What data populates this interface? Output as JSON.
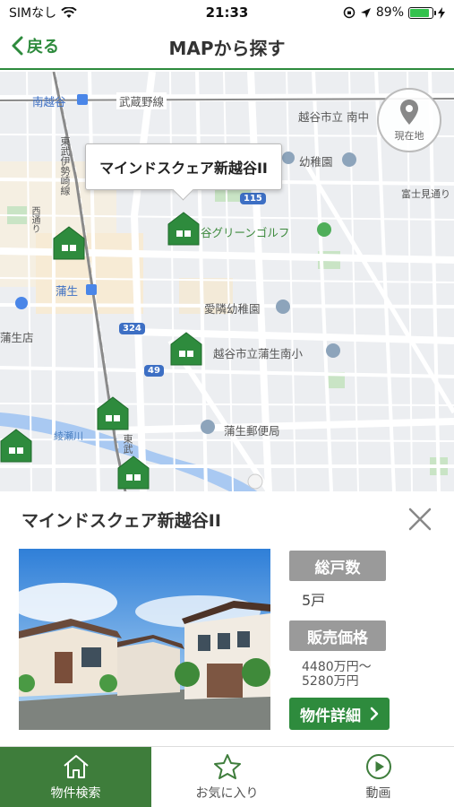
{
  "status_bar": {
    "carrier": "SIMなし",
    "time": "21:33",
    "battery": "89%",
    "battery_level": 0.89
  },
  "nav": {
    "back_label": "戻る",
    "title": "MAPから探す"
  },
  "map": {
    "labels": {
      "minamikoshigaya": "南越谷",
      "musashino_line": "武蔵野線",
      "koshigaya_school": "越谷市立 南中",
      "tobu_isesaki": "東武伊勢崎線",
      "kindergarten1": "幼稚園",
      "fujimi": "富士見通り",
      "golf": "谷グリーンゴルフ",
      "gamo": "蒲生",
      "aizen": "愛隣幼稚園",
      "gamo_store": "蒲生店",
      "gamo_minami": "越谷市立蒲生南小",
      "post_office": "蒲生郵便局",
      "ayase": "綾瀬川",
      "tobu": "東武",
      "road_left": "西通り"
    },
    "shields": [
      "115",
      "324",
      "49"
    ],
    "callout_title": "マインドスクェア新越谷II",
    "locate_label": "現在地"
  },
  "detail": {
    "title": "マインドスクェア新越谷II",
    "units_label": "総戸数",
    "units_value": "5戸",
    "price_label": "販売価格",
    "price_line1": "4480万円〜",
    "price_line2": "5280万円",
    "button_label": "物件詳細"
  },
  "tabs": [
    {
      "label": "物件検索",
      "icon": "home-icon",
      "active": true
    },
    {
      "label": "お気に入り",
      "icon": "star-icon",
      "active": false
    },
    {
      "label": "動画",
      "icon": "play-icon",
      "active": false
    }
  ],
  "colors": {
    "accent": "#2e8b3d",
    "tab_active": "#3e7d3b",
    "badge": "#9a9a9a"
  }
}
